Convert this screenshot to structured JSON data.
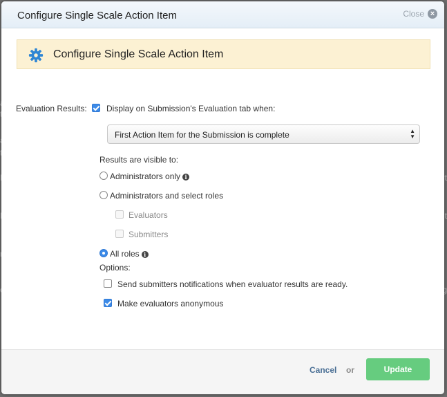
{
  "background_fragments": [
    "ati",
    "t",
    "ati",
    "t",
    "K",
    "K",
    "nc",
    "er",
    "ort",
    "t",
    "ng"
  ],
  "modal": {
    "title": "Configure Single Scale Action Item",
    "close_label": "Close",
    "close_icon": "close-circle-icon"
  },
  "banner": {
    "icon": "gear-icon",
    "title": "Configure Single Scale Action Item",
    "color": "#fcf1d3"
  },
  "evaluation_results": {
    "label": "Evaluation Results:",
    "display_checked": true,
    "display_label": "Display on Submission's Evaluation tab when:",
    "select_value": "First Action Item for the Submission is complete"
  },
  "visibility": {
    "heading": "Results are visible to:",
    "options": [
      {
        "label": "Administrators only",
        "checked": false,
        "info": true
      },
      {
        "label": "Administrators and select roles",
        "checked": false,
        "info": false
      },
      {
        "label": "All roles",
        "checked": true,
        "info": true
      }
    ],
    "roles": [
      {
        "label": "Evaluators",
        "checked": false,
        "disabled": true
      },
      {
        "label": "Submitters",
        "checked": false,
        "disabled": true
      }
    ]
  },
  "options": {
    "heading": "Options:",
    "items": [
      {
        "label": "Send submitters notifications when evaluator results are ready.",
        "checked": false
      },
      {
        "label": "Make evaluators anonymous",
        "checked": true
      }
    ]
  },
  "footer": {
    "cancel_label": "Cancel",
    "or_label": "or",
    "update_label": "Update",
    "update_color": "#66cc7f"
  }
}
